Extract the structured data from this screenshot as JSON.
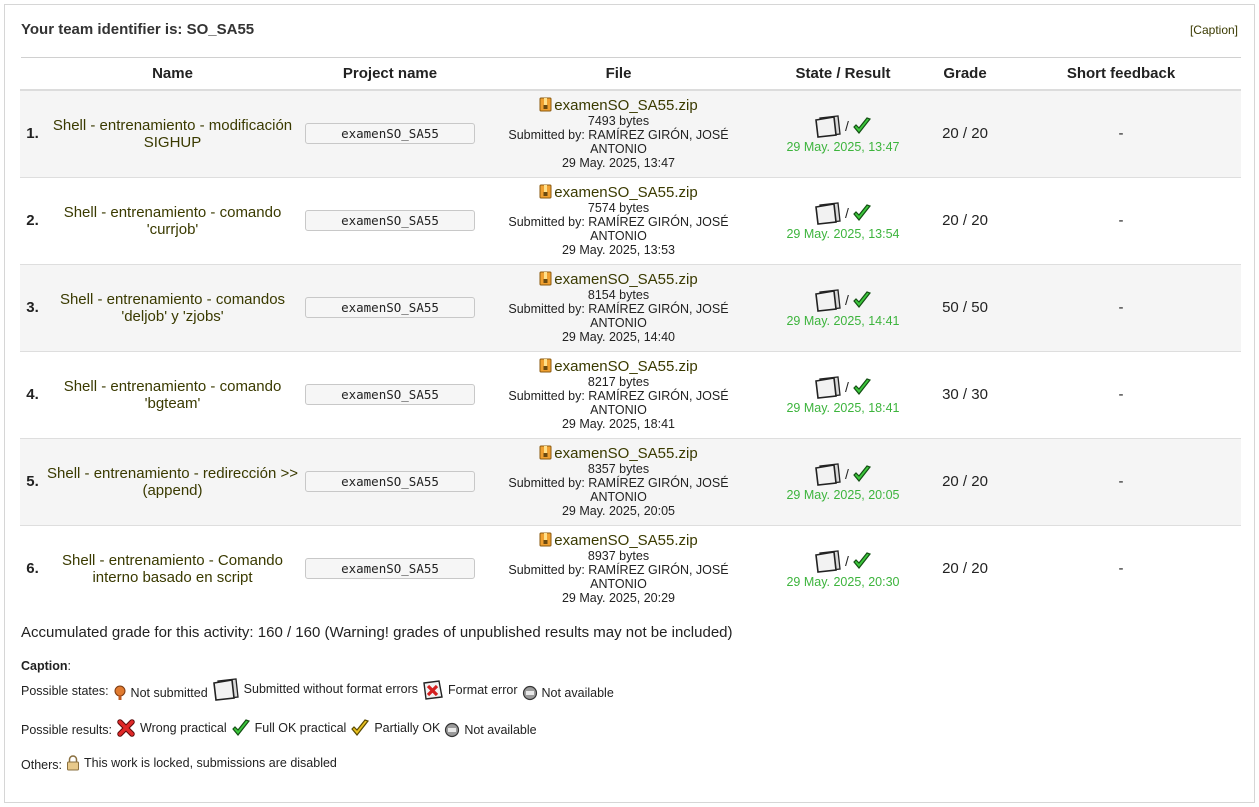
{
  "header": {
    "team_label": "Your team identifier is: SO_SA55",
    "caption_link": "[Caption]"
  },
  "table": {
    "columns": [
      "Name",
      "Project name",
      "File",
      "State / Result",
      "Grade",
      "Short feedback"
    ],
    "rows": [
      {
        "num": "1.",
        "name": "Shell - entrenamiento - modificación SIGHUP",
        "project": "examenSO_SA55",
        "file": "examenSO_SA55.zip",
        "size": "7493 bytes",
        "submitted_by": "Submitted by: RAMÍREZ GIRÓN, JOSÉ ANTONIO",
        "submitted_at": "29 May. 2025, 13:47",
        "result_date": "29 May. 2025, 13:47",
        "grade": "20 / 20",
        "feedback": "-"
      },
      {
        "num": "2.",
        "name": "Shell - entrenamiento - comando 'currjob'",
        "project": "examenSO_SA55",
        "file": "examenSO_SA55.zip",
        "size": "7574 bytes",
        "submitted_by": "Submitted by: RAMÍREZ GIRÓN, JOSÉ ANTONIO",
        "submitted_at": "29 May. 2025, 13:53",
        "result_date": "29 May. 2025, 13:54",
        "grade": "20 / 20",
        "feedback": "-"
      },
      {
        "num": "3.",
        "name": "Shell - entrenamiento - comandos 'deljob' y 'zjobs'",
        "project": "examenSO_SA55",
        "file": "examenSO_SA55.zip",
        "size": "8154 bytes",
        "submitted_by": "Submitted by: RAMÍREZ GIRÓN, JOSÉ ANTONIO",
        "submitted_at": "29 May. 2025, 14:40",
        "result_date": "29 May. 2025, 14:41",
        "grade": "50 / 50",
        "feedback": "-"
      },
      {
        "num": "4.",
        "name": "Shell - entrenamiento - comando 'bgteam'",
        "project": "examenSO_SA55",
        "file": "examenSO_SA55.zip",
        "size": "8217 bytes",
        "submitted_by": "Submitted by: RAMÍREZ GIRÓN, JOSÉ ANTONIO",
        "submitted_at": "29 May. 2025, 18:41",
        "result_date": "29 May. 2025, 18:41",
        "grade": "30 / 30",
        "feedback": "-"
      },
      {
        "num": "5.",
        "name": "Shell - entrenamiento - redirección >> (append)",
        "project": "examenSO_SA55",
        "file": "examenSO_SA55.zip",
        "size": "8357 bytes",
        "submitted_by": "Submitted by: RAMÍREZ GIRÓN, JOSÉ ANTONIO",
        "submitted_at": "29 May. 2025, 20:05",
        "result_date": "29 May. 2025, 20:05",
        "grade": "20 / 20",
        "feedback": "-"
      },
      {
        "num": "6.",
        "name": "Shell - entrenamiento - Comando interno basado en script",
        "project": "examenSO_SA55",
        "file": "examenSO_SA55.zip",
        "size": "8937 bytes",
        "submitted_by": "Submitted by: RAMÍREZ GIRÓN, JOSÉ ANTONIO",
        "submitted_at": "29 May. 2025, 20:29",
        "result_date": "29 May. 2025, 20:30",
        "grade": "20 / 20",
        "feedback": "-"
      }
    ],
    "state_separator": "/"
  },
  "accumulated": "Accumulated grade for this activity: 160 / 160 (Warning! grades of unpublished results may not be included)",
  "caption": {
    "title": "Caption",
    "states_label": "Possible states:",
    "states": [
      {
        "icon": "not-submitted-icon",
        "label": "Not submitted"
      },
      {
        "icon": "submitted-ok-icon",
        "label": "Submitted without format errors"
      },
      {
        "icon": "format-error-icon",
        "label": "Format error"
      },
      {
        "icon": "not-available-icon",
        "label": "Not available"
      }
    ],
    "results_label": "Possible results:",
    "results": [
      {
        "icon": "wrong-icon",
        "label": "Wrong practical"
      },
      {
        "icon": "full-ok-icon",
        "label": "Full OK practical"
      },
      {
        "icon": "partial-ok-icon",
        "label": "Partially OK"
      },
      {
        "icon": "not-available-icon",
        "label": "Not available"
      }
    ],
    "others_label": "Others:",
    "others": [
      {
        "icon": "lock-icon",
        "label": "This work is locked, submissions are disabled"
      }
    ]
  },
  "colors": {
    "link": "#3a3a00",
    "result_date": "#3db43d",
    "row_stripe": "#f5f5f5"
  }
}
